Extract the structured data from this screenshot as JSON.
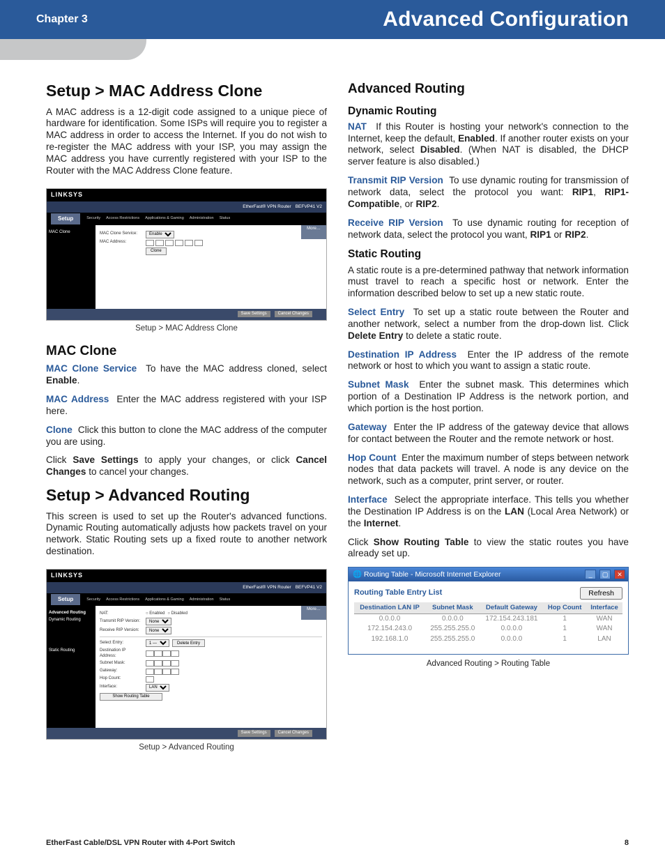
{
  "header": {
    "chapter": "Chapter 3",
    "title": "Advanced Configuration"
  },
  "left": {
    "h_mac_clone_setup": "Setup > MAC Address Clone",
    "p_mac_intro": "A MAC address is a 12-digit code assigned to a unique piece of hardware for identification. Some ISPs will require you to register a MAC address in order to access the Internet. If you do not wish to re-register the MAC address with your ISP, you may assign the MAC address you have currently registered with your ISP to the Router with the MAC Address Clone feature.",
    "fig1_caption": "Setup > MAC Address Clone",
    "h_mac_clone": "MAC Clone",
    "mac_clone_service_term": "MAC Clone Service",
    "mac_clone_service_text": "To have the MAC address cloned, select ",
    "mac_clone_service_bold": "Enable",
    "mac_clone_service_tail": ".",
    "mac_address_term": "MAC Address",
    "mac_address_text": "Enter the MAC address registered with your ISP here.",
    "clone_term": "Clone",
    "clone_text": "Click this button to clone the MAC address of the computer you are using.",
    "save_para_a": "Click ",
    "save_para_b": "Save Settings",
    "save_para_c": " to apply your changes, or click ",
    "save_para_d": "Cancel Changes",
    "save_para_e": " to cancel your changes.",
    "h_adv_routing_setup": "Setup > Advanced Routing",
    "p_adv_intro": "This screen is used to set up the Router's advanced functions. Dynamic Routing automatically adjusts how packets travel on your network. Static Routing sets up a fixed route to another network destination.",
    "fig2_caption": "Setup > Advanced Routing",
    "mini1": {
      "brand": "LINKSYS",
      "bar_model": "EtherFast® VPN Router",
      "bar_sku": "BEFVP41 V2",
      "setup": "Setup",
      "tabs": [
        "Setup",
        "Security",
        "Access Restrictions",
        "Applications & Gaming",
        "Administration",
        "Status"
      ],
      "side": [
        "MAC Clone"
      ],
      "rows": {
        "svc_label": "MAC Clone Service:",
        "svc_value": "Enable",
        "addr_label": "MAC Address:",
        "clone_btn": "Clone"
      },
      "more": "More…",
      "foot_save": "Save Settings",
      "foot_cancel": "Cancel Changes"
    },
    "mini2": {
      "brand": "LINKSYS",
      "bar_model": "EtherFast® VPN Router",
      "bar_sku": "BEFVP41 V2",
      "setup": "Setup",
      "tabs": [
        "Setup",
        "Security",
        "Access Restrictions",
        "Applications & Gaming",
        "Administration",
        "Status"
      ],
      "side_title": "Advanced Routing",
      "side": [
        "Dynamic Routing",
        "",
        "Static Routing"
      ],
      "dyn": {
        "nat_label": "NAT:",
        "nat_en": "Enabled",
        "nat_dis": "Disabled",
        "trip_label": "Transmit RIP Version:",
        "trip_val": "None",
        "rrip_label": "Receive RIP Version:",
        "rrip_val": "None"
      },
      "stat": {
        "sel_label": "Select Entry:",
        "sel_val": "1 —",
        "del_btn": "Delete Entry",
        "dest_label": "Destination IP Address:",
        "mask_label": "Subnet Mask:",
        "gw_label": "Gateway:",
        "hop_label": "Hop Count:",
        "if_label": "Interface:",
        "if_val": "LAN",
        "show_btn": "Show Routing Table"
      },
      "more": "More…",
      "foot_save": "Save Settings",
      "foot_cancel": "Cancel Changes"
    }
  },
  "right": {
    "h_adv_routing": "Advanced Routing",
    "h_dynamic": "Dynamic Routing",
    "nat_term": "NAT",
    "nat_a": "If this Router is hosting your network's connection to the Internet, keep the default, ",
    "nat_b": "Enabled",
    "nat_c": ". If another router exists on your network, select ",
    "nat_d": "Disabled",
    "nat_e": ". (When NAT is disabled, the DHCP server feature is also disabled.)",
    "trip_term": "Transmit RIP Version",
    "trip_a": "To use dynamic routing for transmission of network data, select the protocol you want: ",
    "trip_b": "RIP1",
    "trip_c": ", ",
    "trip_d": "RIP1-Compatible",
    "trip_e": ", or ",
    "trip_f": "RIP2",
    "trip_g": ".",
    "rrip_term": "Receive RIP Version",
    "rrip_a": "To use dynamic routing for reception of network data, select the protocol you want, ",
    "rrip_b": "RIP1",
    "rrip_c": " or ",
    "rrip_d": "RIP2",
    "rrip_e": ".",
    "h_static": "Static Routing",
    "p_static_intro": "A static route is a pre-determined pathway that network information must travel to reach a specific host or network. Enter the information described below to set up a new static route.",
    "sel_term": "Select Entry",
    "sel_a": "To set up a static route between the Router and another network, select a number from the drop-down list. Click ",
    "sel_b": "Delete Entry",
    "sel_c": " to delete a static route.",
    "dest_term": "Destination IP Address",
    "dest_text": "Enter the IP address of the remote network or host to which you want to assign a static route.",
    "mask_term": "Subnet Mask",
    "mask_text": "Enter the subnet mask. This determines which portion of a Destination IP Address is the network portion, and which portion is the host portion.",
    "gw_term": "Gateway",
    "gw_text": "Enter the IP address of the gateway device that allows for contact between the Router and the remote network or host.",
    "hop_term": "Hop Count",
    "hop_text": "Enter the maximum number of steps between network nodes that data packets will travel. A node is any device on the network, such as a computer, print server, or router.",
    "if_term": "Interface",
    "if_a": "Select the appropriate interface. This tells you whether the Destination IP Address is on the ",
    "if_b": "LAN",
    "if_c": " (Local Area Network) or the ",
    "if_d": "Internet",
    "if_e": ".",
    "show_a": "Click ",
    "show_b": "Show Routing Table",
    "show_c": " to view the static routes you have already set up.",
    "rt_caption": "Advanced Routing > Routing Table",
    "rt": {
      "wintitle": "Routing Table - Microsoft Internet Explorer",
      "list_label": "Routing Table Entry List",
      "refresh": "Refresh",
      "cols": [
        "Destination LAN IP",
        "Subnet Mask",
        "Default Gateway",
        "Hop Count",
        "Interface"
      ],
      "rows": [
        [
          "0.0.0.0",
          "0.0.0.0",
          "172.154.243.181",
          "1",
          "WAN"
        ],
        [
          "172.154.243.0",
          "255.255.255.0",
          "0.0.0.0",
          "1",
          "WAN"
        ],
        [
          "192.168.1.0",
          "255.255.255.0",
          "0.0.0.0",
          "1",
          "LAN"
        ]
      ]
    }
  },
  "footer": {
    "product": "EtherFast Cable/DSL VPN Router with 4-Port Switch",
    "page": "8"
  }
}
